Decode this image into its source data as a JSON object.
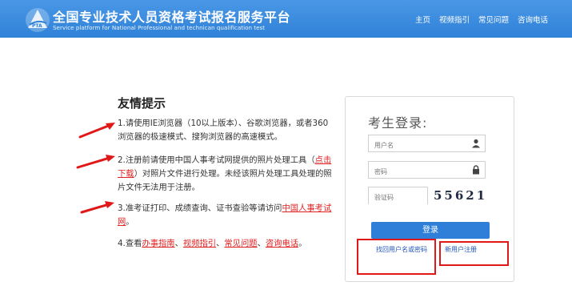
{
  "header": {
    "title_cn": "全国专业技术人员资格考试报名服务平台",
    "title_en": "Service platform for National Professional and technican qualification test",
    "nav": [
      "主页",
      "视频指引",
      "常见问题",
      "咨询电话"
    ]
  },
  "tips": {
    "title": "友情提示",
    "tip1": "1.请使用IE浏览器（10以上版本）、谷歌浏览器，或者360浏览器的极速模式、搜狗浏览器的高速模式。",
    "tip2_a": "2.注册前请使用中国人事考试网提供的照片处理工具（",
    "tip2_link": "点击下载",
    "tip2_b": "）对照片文件进行处理。未经该照片处理工具处理的照片文件无法用于注册。",
    "tip3_a": "3.准考证打印、成绩查询、证书查验等请访问",
    "tip3_link": "中国人事考试网",
    "tip3_b": "。",
    "tip4_a": "4.查看",
    "tip4_links": [
      "办事指南",
      "视频指引",
      "常见问题",
      "咨询电话"
    ],
    "tip4_sep": "、",
    "tip4_end": "。"
  },
  "login": {
    "title": "考生登录:",
    "username_placeholder": "用户名",
    "password_placeholder": "密码",
    "captcha_placeholder": "验证码",
    "captcha_text": "55621",
    "login_button": "登录",
    "find_account": "找回用户名或密码",
    "register": "新用户注册"
  },
  "colors": {
    "header_blue": "#3d8ee0",
    "annotation_red": "#e01818",
    "link_red": "#e02020"
  }
}
